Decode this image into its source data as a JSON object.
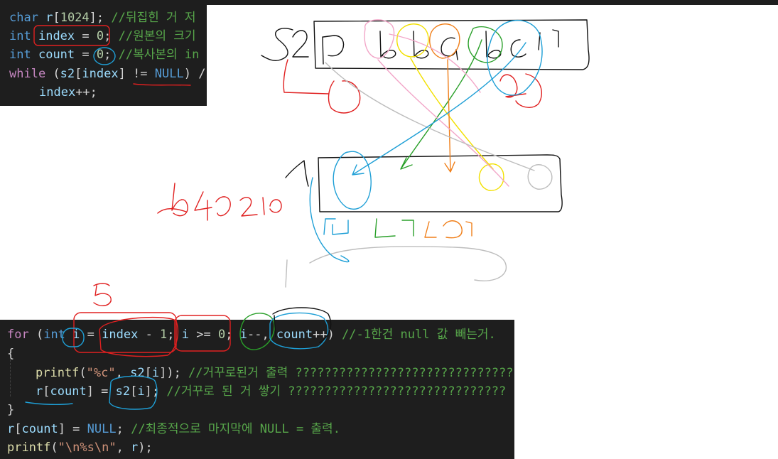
{
  "code_top": {
    "lines": [
      [
        {
          "t": "char",
          "c": "kw"
        },
        {
          "t": " ",
          "c": "op"
        },
        {
          "t": "r",
          "c": "var"
        },
        {
          "t": "[",
          "c": "op"
        },
        {
          "t": "1024",
          "c": "num"
        },
        {
          "t": "]; ",
          "c": "op"
        },
        {
          "t": "//뒤집힌 거 저",
          "c": "cmt"
        }
      ],
      [
        {
          "t": "int",
          "c": "kw"
        },
        {
          "t": " ",
          "c": "op"
        },
        {
          "t": "index",
          "c": "var"
        },
        {
          "t": " = ",
          "c": "op"
        },
        {
          "t": "0",
          "c": "num"
        },
        {
          "t": "; ",
          "c": "op"
        },
        {
          "t": "//원본의 크기",
          "c": "cmt"
        }
      ],
      [
        {
          "t": "int",
          "c": "kw"
        },
        {
          "t": " ",
          "c": "op"
        },
        {
          "t": "count",
          "c": "var"
        },
        {
          "t": " = ",
          "c": "op"
        },
        {
          "t": "0",
          "c": "num"
        },
        {
          "t": "; ",
          "c": "op"
        },
        {
          "t": "//복사본의 in",
          "c": "cmt"
        }
      ],
      [
        {
          "t": "while",
          "c": "ctl"
        },
        {
          "t": " (",
          "c": "op"
        },
        {
          "t": "s2",
          "c": "var"
        },
        {
          "t": "[",
          "c": "op"
        },
        {
          "t": "index",
          "c": "var"
        },
        {
          "t": "] != ",
          "c": "op"
        },
        {
          "t": "NULL",
          "c": "kw"
        },
        {
          "t": ") /",
          "c": "op"
        }
      ],
      [
        {
          "t": "index",
          "c": "var"
        },
        {
          "t": "++;",
          "c": "op"
        }
      ]
    ]
  },
  "code_bottom": {
    "lines": [
      [
        {
          "t": "for",
          "c": "ctl"
        },
        {
          "t": " (",
          "c": "op"
        },
        {
          "t": "int",
          "c": "kw"
        },
        {
          "t": " ",
          "c": "op"
        },
        {
          "t": "i",
          "c": "var"
        },
        {
          "t": " = ",
          "c": "op"
        },
        {
          "t": "index",
          "c": "var"
        },
        {
          "t": " - ",
          "c": "op"
        },
        {
          "t": "1",
          "c": "num"
        },
        {
          "t": "; ",
          "c": "op"
        },
        {
          "t": "i",
          "c": "var"
        },
        {
          "t": " >= ",
          "c": "op"
        },
        {
          "t": "0",
          "c": "num"
        },
        {
          "t": "; ",
          "c": "op"
        },
        {
          "t": "i",
          "c": "var"
        },
        {
          "t": "--, ",
          "c": "op"
        },
        {
          "t": "count",
          "c": "var"
        },
        {
          "t": "++) ",
          "c": "op"
        },
        {
          "t": "//-1한건 null 값 빼는거.",
          "c": "cmt"
        }
      ],
      [
        {
          "t": "{",
          "c": "op"
        }
      ],
      [
        {
          "t": "printf",
          "c": "fn"
        },
        {
          "t": "(",
          "c": "op"
        },
        {
          "t": "\"%c\"",
          "c": "str"
        },
        {
          "t": ", ",
          "c": "op"
        },
        {
          "t": "s2",
          "c": "var"
        },
        {
          "t": "[",
          "c": "op"
        },
        {
          "t": "i",
          "c": "var"
        },
        {
          "t": "]); ",
          "c": "op"
        },
        {
          "t": "//거꾸로된거 출력 ??????????????????????????????",
          "c": "cmt"
        }
      ],
      [
        {
          "t": "r",
          "c": "var"
        },
        {
          "t": "[",
          "c": "op"
        },
        {
          "t": "count",
          "c": "var"
        },
        {
          "t": "] = ",
          "c": "op"
        },
        {
          "t": "s2",
          "c": "var"
        },
        {
          "t": "[",
          "c": "op"
        },
        {
          "t": "i",
          "c": "var"
        },
        {
          "t": "]; ",
          "c": "op"
        },
        {
          "t": "//거꾸로 된 거 쌓기 ??????????????????????????????",
          "c": "cmt"
        }
      ],
      [
        {
          "t": "}",
          "c": "op"
        }
      ],
      [
        {
          "t": "r",
          "c": "var"
        },
        {
          "t": "[",
          "c": "op"
        },
        {
          "t": "count",
          "c": "var"
        },
        {
          "t": "] = ",
          "c": "op"
        },
        {
          "t": "NULL",
          "c": "kw"
        },
        {
          "t": "; ",
          "c": "op"
        },
        {
          "t": "//최종적으로 마지막에 NULL = 출력.",
          "c": "cmt"
        }
      ],
      [
        {
          "t": "printf",
          "c": "fn"
        },
        {
          "t": "(",
          "c": "op"
        },
        {
          "t": "\"\\n%s\\n\"",
          "c": "str"
        },
        {
          "t": ", ",
          "c": "op"
        },
        {
          "t": "r",
          "c": "var"
        },
        {
          "t": ");",
          "c": "op"
        }
      ]
    ]
  },
  "colors": {
    "editor_bg": "#1e1e1e",
    "ink_red": "#e02020",
    "ink_black": "#111111",
    "ink_blue": "#1e9fd6",
    "ink_green": "#2aa02a",
    "ink_yellow": "#f2e000",
    "ink_orange": "#f07f1a",
    "ink_pink": "#f2a6c8",
    "ink_gray": "#bdbdbd"
  }
}
